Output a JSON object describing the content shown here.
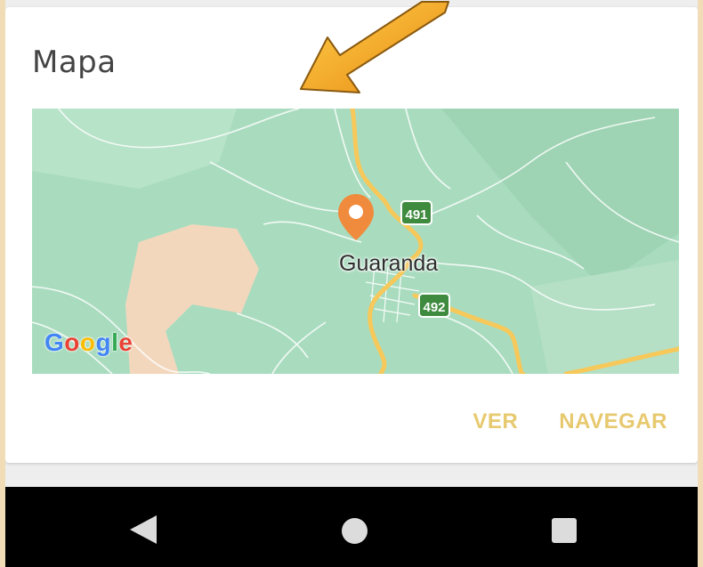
{
  "card": {
    "title": "Mapa"
  },
  "map": {
    "city": "Guaranda",
    "shields": [
      "491",
      "492"
    ],
    "provider_letters": [
      {
        "ch": "G",
        "color": "#4285F4"
      },
      {
        "ch": "o",
        "color": "#EA4335"
      },
      {
        "ch": "o",
        "color": "#FBBC05"
      },
      {
        "ch": "g",
        "color": "#4285F4"
      },
      {
        "ch": "l",
        "color": "#34A853"
      },
      {
        "ch": "e",
        "color": "#EA4335"
      }
    ],
    "colors": {
      "land": "#a9dcbf",
      "road_major": "#f7c85a",
      "pin": "#f08a3c",
      "shield": "#3e8a3e"
    }
  },
  "actions": {
    "view_label": "VER",
    "navigate_label": "NAVEGAR",
    "accent_color": "#e7c96f"
  },
  "navbar": {
    "back_icon": "back-triangle",
    "home_icon": "home-circle",
    "recents_icon": "recents-square"
  },
  "overlay": {
    "arrow_color": "#f5a623"
  }
}
